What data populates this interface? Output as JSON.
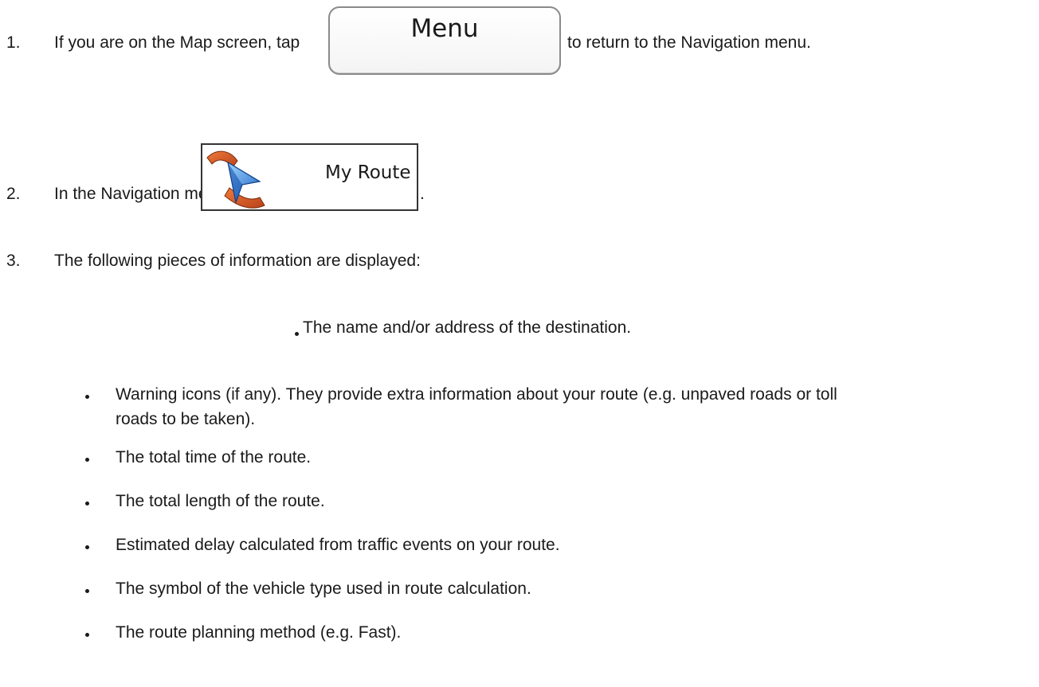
{
  "steps": [
    {
      "number": "1.",
      "before": "If you are on the Map screen, tap",
      "after": "to return to the Navigation menu."
    },
    {
      "number": "2.",
      "before": "In the Navigation menu, tap",
      "after": "."
    },
    {
      "number": "3.",
      "text": "The following pieces of information are displayed:"
    }
  ],
  "buttons": {
    "menu_label": "Menu",
    "my_route_label": "My Route",
    "my_route_icon": "route-arrow-icon"
  },
  "first_item": "The name and/or address of the destination.",
  "bullets": [
    {
      "line1": "Warning icons (if any). They provide extra information about your route (e.g. unpaved roads or toll",
      "line2": "roads to be taken)."
    },
    {
      "line1": "The total time of the route."
    },
    {
      "line1": "The total length of the route."
    },
    {
      "line1": "Estimated delay calculated from traffic events on your route."
    },
    {
      "line1": "The symbol of the vehicle type used in route calculation."
    },
    {
      "line1": "The route planning method (e.g. Fast)."
    }
  ]
}
